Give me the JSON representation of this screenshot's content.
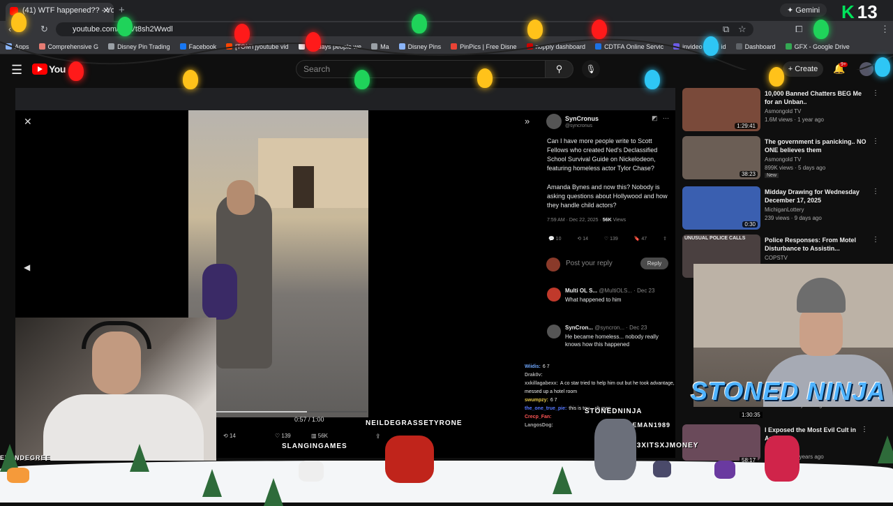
{
  "browser": {
    "tab_title": "(41) WTF happened?? - You",
    "gemini_label": "Gemini",
    "overlay_counter": "13",
    "url": "youtube.com/w  kVt8sh2Wwdl",
    "bookmarks": [
      "Apps",
      "Comprehensive G",
      "Disney Pin Trading",
      "Facebook",
      "[TOMT]youtube vid",
      "If todays people we",
      "Ma",
      "Disney Pins",
      "PinPics | Free Disne",
      "nopply dashboard",
      "CDTFA Online Servic",
      "invideo",
      "id",
      "Dashboard",
      "GFX - Google Drive"
    ]
  },
  "youtube": {
    "search_placeholder": "Search",
    "create_label": "Create",
    "notif_count": "9+"
  },
  "video": {
    "time": "0:57 / 1:00",
    "footer_retweets": "14",
    "footer_likes": "139",
    "footer_views": "56K"
  },
  "tweet": {
    "author": "SynCronus",
    "handle": "@syncronus",
    "body1": "Can I have more people write to Scott Fellows who created Ned's Declassified School Survival Guide on Nickelodeon, featuring homeless actor Tylor Chase?",
    "body2": "Amanda Bynes and now this? Nobody is asking questions about Hollywood and how they handle child actors?",
    "timestamp": "7:59 AM · Dec 22, 2025 ·",
    "views": "56K",
    "views_label": "Views",
    "replies": "10",
    "retweets": "14",
    "likes": "139",
    "bookmarks": "47",
    "reply_placeholder": "Post your reply",
    "reply_button": "Reply",
    "replies_list": [
      {
        "name": "Multi OL S...",
        "handle": "@MultiOLS... · Dec 23",
        "text": "What happened to him"
      },
      {
        "name": "SynCron...",
        "handle": "@syncron... · Dec 23",
        "text": "He became homeless... nobody really knows how this happened"
      }
    ]
  },
  "chat": [
    {
      "name": "Wiidis:",
      "text": "6 7",
      "color": "#6fa8ff"
    },
    {
      "name": "Drak0v:",
      "text": "",
      "color": "#aaaaaa"
    },
    {
      "name": "xxkillagabexx:",
      "text": "A co star tried to help him out but he took advantage, messed up a hotel room",
      "color": "#b0b0b0"
    },
    {
      "name": "swumpzy:",
      "text": "6 7",
      "color": "#e6c84a"
    },
    {
      "name": "the_one_true_pie:",
      "text": "this is tou... ch man",
      "color": "#5577ff"
    },
    {
      "name": "Crecp_Fan:",
      "text": "",
      "color": "#ff5555"
    },
    {
      "name": "LangosDog:",
      "text": "",
      "color": "#aaaaaa"
    }
  ],
  "recommendations": [
    {
      "title": "10,000 Banned Chatters BEG Me for an Unban..",
      "channel": "Asmongold TV",
      "stats": "1.6M views · 1 year ago",
      "duration": "1:29:41",
      "badge": "",
      "thumb": "#7a4a3a"
    },
    {
      "title": "The government is panicking.. NO ONE believes them",
      "channel": "Asmongold TV",
      "stats": "899K views · 5 days ago",
      "duration": "38:23",
      "badge": "New",
      "thumb": "#6b5e55"
    },
    {
      "title": "Midday Drawing for Wednesday December 17, 2025",
      "channel": "MichiganLottery",
      "stats": "239 views · 9 days ago",
      "duration": "0:30",
      "badge": "",
      "thumb": "#3a5fb0"
    },
    {
      "title": "Police Responses: From Motel Disturbance to Assistin...",
      "channel": "COPSTV",
      "stats": "",
      "duration": "",
      "badge": "",
      "thumb": "#4a4040"
    }
  ],
  "rec_partial": {
    "stats": "1.8M views · 2 years ago",
    "duration": "1:30:35",
    "title": "I Exposed the Most Evil Cult in America",
    "stats2": "... 2 years ago",
    "duration2": "58:17"
  },
  "thumb_overlay_text": "UNUSUAL POLICE CALLS",
  "overlays": {
    "stoned_ninja": "STONED NINJA",
    "stoned_ninja_small": "STONEDNINJA",
    "slanging": "SLANGINGAMES",
    "neil": "NEILDEGRASSETYRONE",
    "h03x": "H03XITSXJMONEY",
    "hippieman": "HIPPIEMAN1989",
    "evendegree": "EVENDEGREE"
  }
}
